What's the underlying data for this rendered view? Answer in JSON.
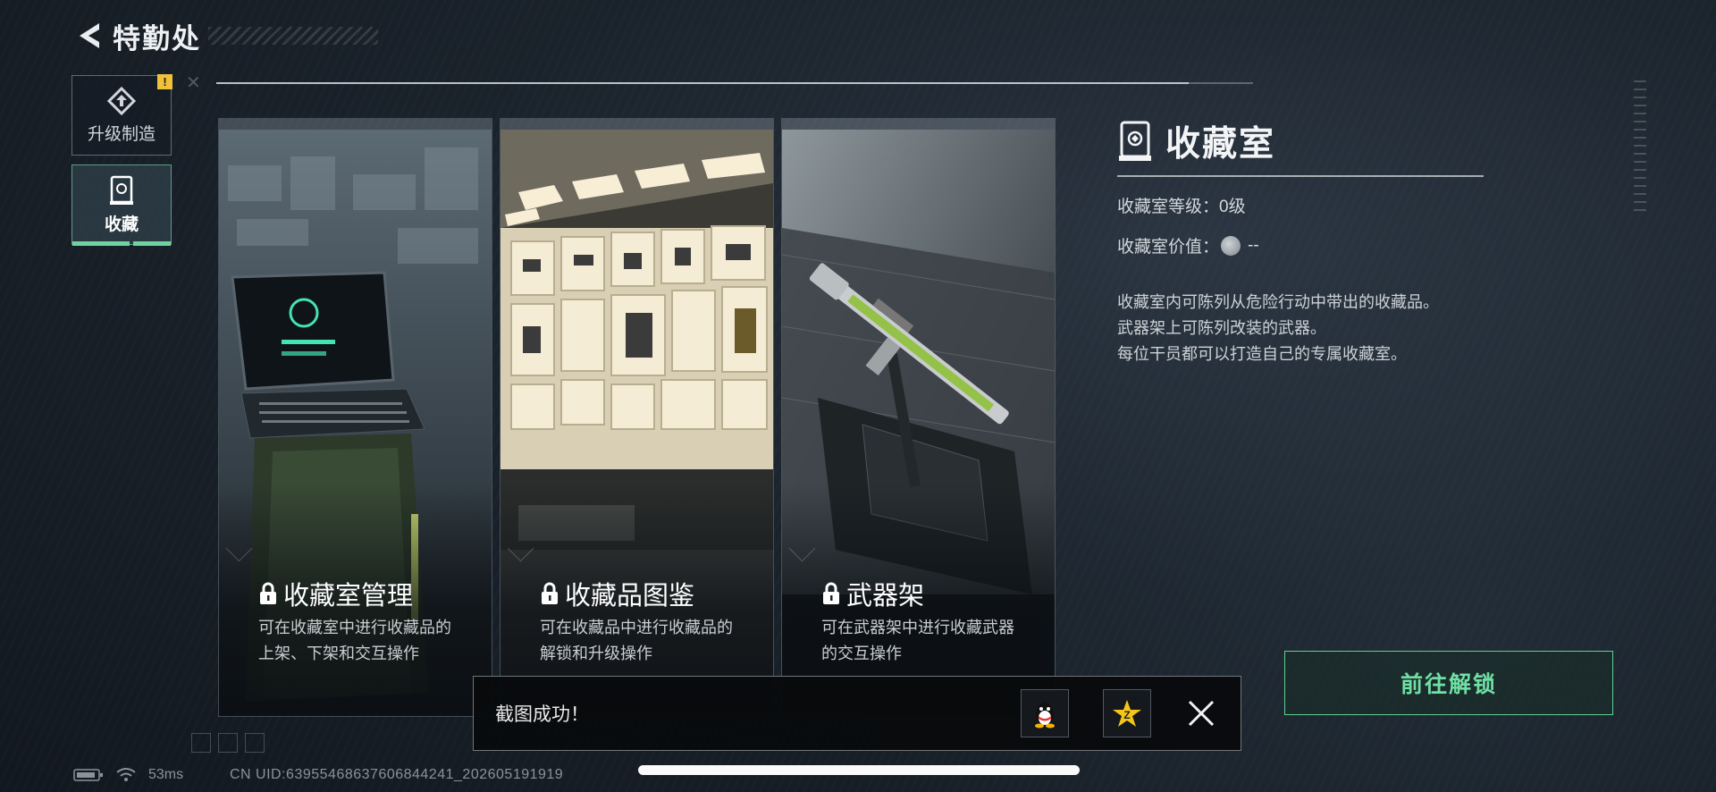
{
  "header": {
    "title": "特勤处"
  },
  "sidebar": {
    "items": [
      {
        "label": "升级制造",
        "icon": "upgrade-craft-icon",
        "badge": "!"
      },
      {
        "label": "收藏",
        "icon": "collection-icon",
        "active": true
      }
    ]
  },
  "cards": [
    {
      "title": "收藏室管理",
      "desc_line1": "可在收藏室中进行收藏品的",
      "desc_line2": "上架、下架和交互操作",
      "locked": true
    },
    {
      "title": "收藏品图鉴",
      "desc_line1": "可在收藏品中进行收藏品的",
      "desc_line2": "解锁和升级操作",
      "locked": true
    },
    {
      "title": "武器架",
      "desc_line1": "可在武器架中进行收藏武器",
      "desc_line2": "的交互操作",
      "locked": true
    }
  ],
  "info": {
    "title": "收藏室",
    "level_label": "收藏室等级：",
    "level_value": "0级",
    "value_label": "收藏室价值：",
    "value_value": "--",
    "desc_line1": "收藏室内可陈列从危险行动中带出的收藏品。",
    "desc_line2": "武器架上可陈列改装的武器。",
    "desc_line3": "每位干员都可以打造自己的专属收藏室。"
  },
  "unlock_button": {
    "label": "前往解锁"
  },
  "toast": {
    "text": "截图成功！",
    "share_qq_icon": "qq-penguin-icon",
    "share_qzone_icon": "qzone-star-icon"
  },
  "status_bar": {
    "ping": "53ms",
    "uid": "CN UID:6395546863760684424​1_202605191919"
  },
  "colors": {
    "accent_green": "#6fe0a4",
    "warning": "#f0c23a"
  }
}
